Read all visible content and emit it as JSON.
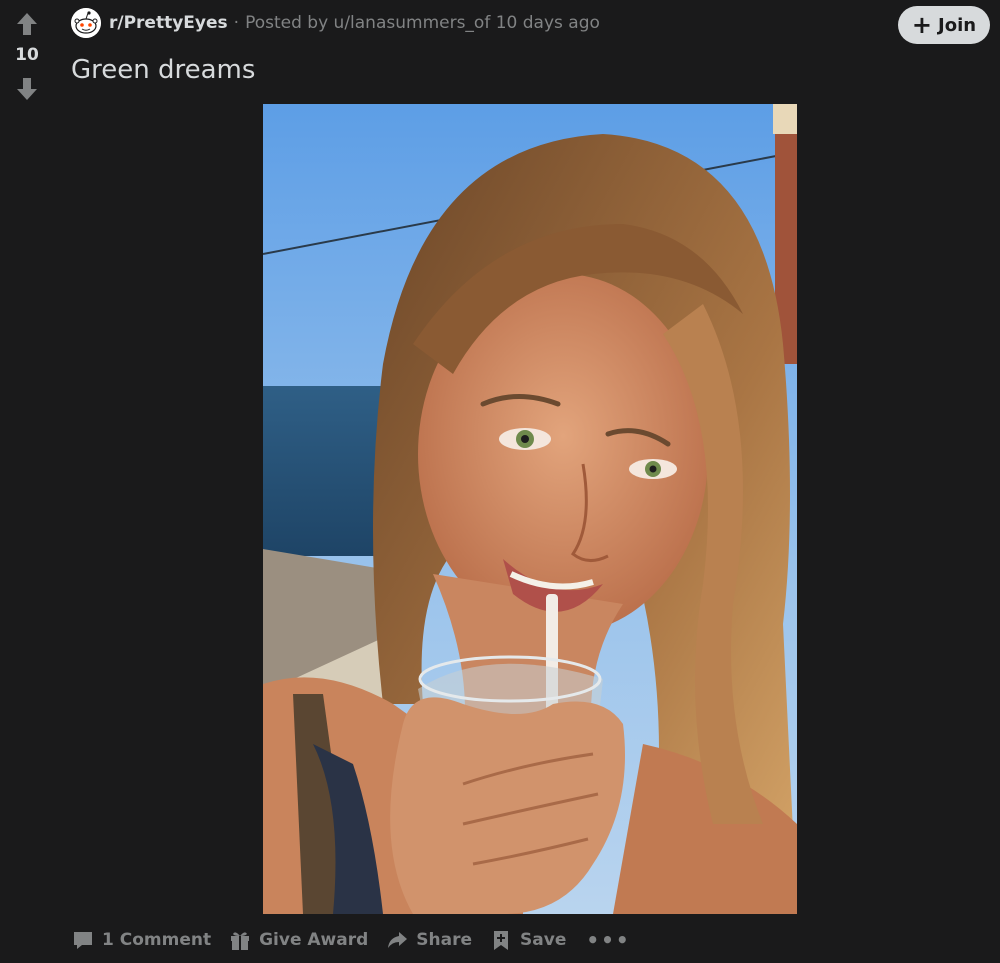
{
  "vote": {
    "score": "10"
  },
  "post": {
    "subreddit": "r/PrettyEyes",
    "separator": "·",
    "posted_by": "Posted by u/lanasummers_of 10 days ago",
    "title": "Green dreams"
  },
  "join": {
    "label": "Join"
  },
  "actions": {
    "comments": "1 Comment",
    "award": "Give Award",
    "share": "Share",
    "save": "Save",
    "more": "•••"
  },
  "colors": {
    "background": "#1a1a1b",
    "text": "#d7dadc",
    "muted": "#818384",
    "join_bg": "#d7dadc"
  },
  "icons": {
    "upvote": "arrow-up-icon",
    "downvote": "arrow-down-icon",
    "subreddit": "reddit-snoo-icon",
    "comment": "comment-icon",
    "award": "gift-icon",
    "share": "share-arrow-icon",
    "save": "bookmark-plus-icon",
    "more": "ellipsis-icon"
  }
}
